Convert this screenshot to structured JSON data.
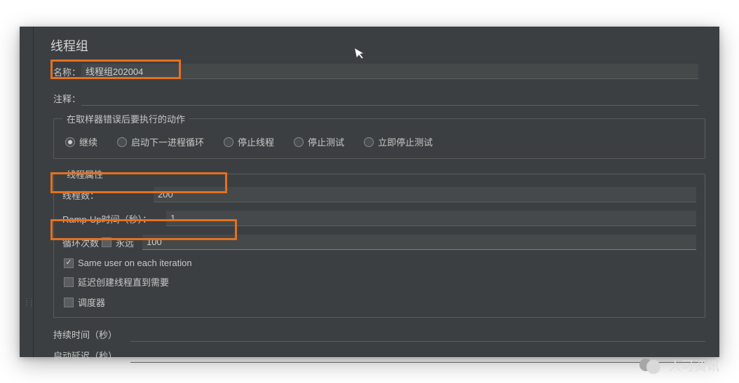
{
  "panel": {
    "title": "线程组",
    "name_label": "名称：",
    "name_value": "线程组202004",
    "comment_label": "注释："
  },
  "error_action": {
    "legend": "在取样器错误后要执行的动作",
    "options": {
      "continue": "继续",
      "start_next": "启动下一进程循环",
      "stop_thread": "停止线程",
      "stop_test": "停止测试",
      "stop_test_now": "立即停止测试"
    },
    "selected": "continue"
  },
  "thread_props": {
    "legend": "线程属性",
    "threads_label": "线程数：",
    "threads_value": "200",
    "rampup_label": "Ramp-Up时间（秒）：",
    "rampup_value": "1",
    "loop_label": "循环次数",
    "forever_label": "永远",
    "loop_value": "100",
    "same_user_label": "Same user on each iteration",
    "delay_create_label": "延迟创建线程直到需要",
    "scheduler_label": "调度器"
  },
  "schedule": {
    "duration_label": "持续时间（秒）",
    "delay_label": "启动延迟（秒）"
  },
  "brand": {
    "text": "人可资讯"
  }
}
